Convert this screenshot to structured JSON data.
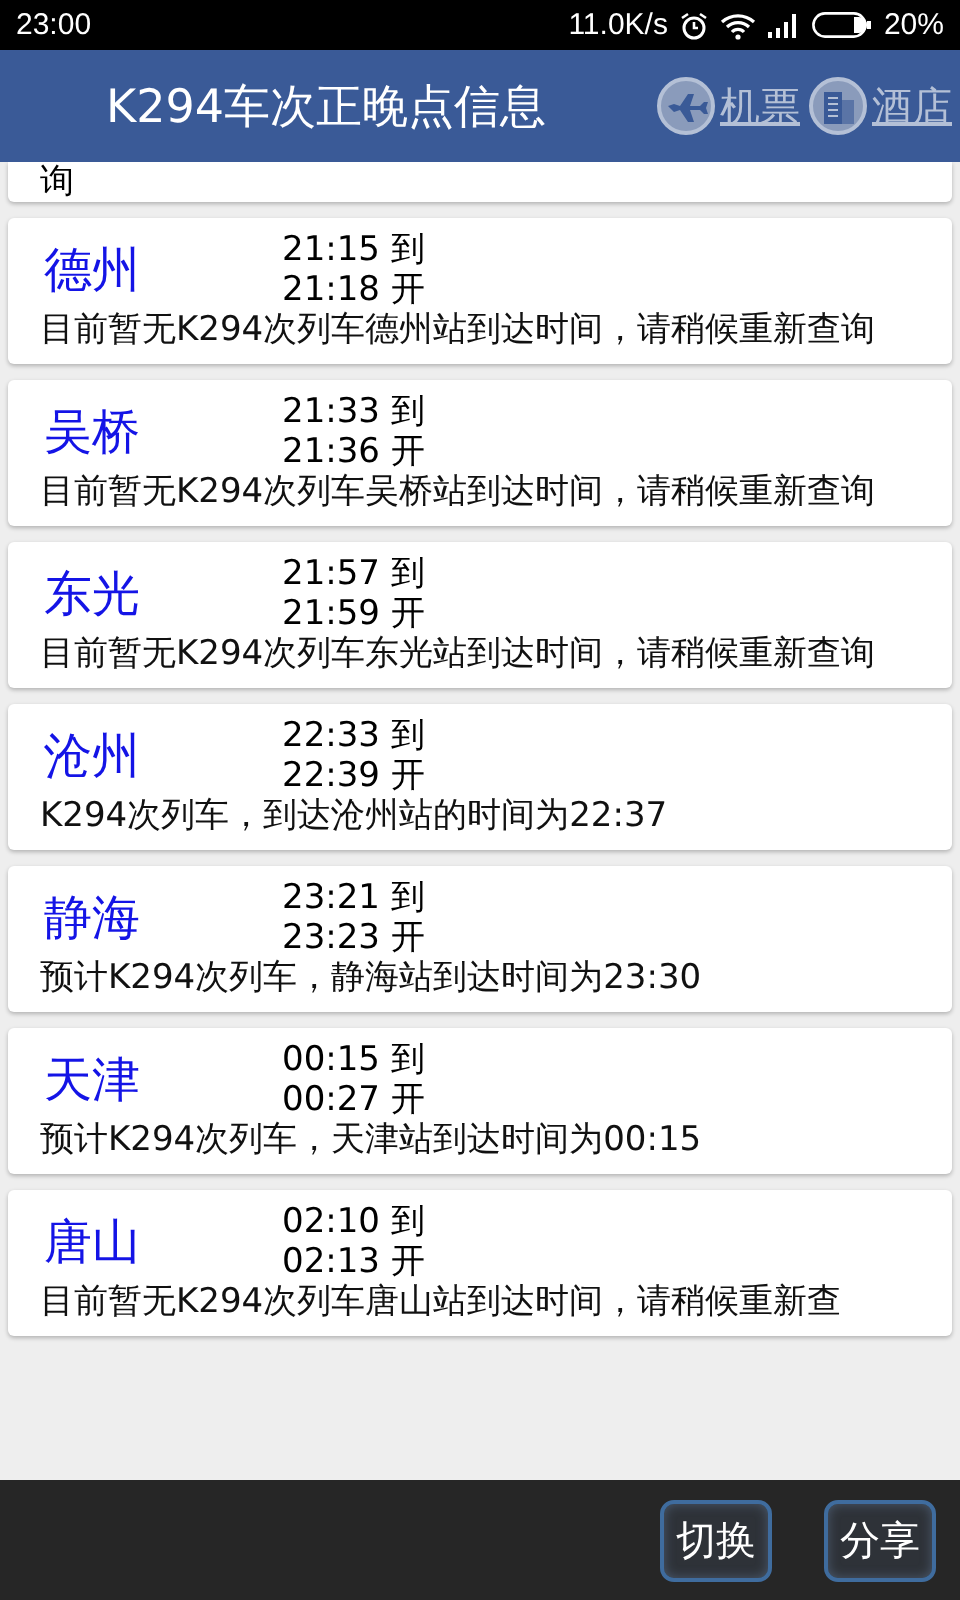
{
  "status_bar": {
    "time": "23:00",
    "speed": "11.0K/s",
    "battery": "20%"
  },
  "header": {
    "title": "K294车次正晚点信息",
    "links": [
      {
        "label": "机票",
        "kind": "plane"
      },
      {
        "label": "酒店",
        "kind": "hotel"
      }
    ]
  },
  "top_fragment": "询",
  "stations": [
    {
      "name": "德州",
      "arrive": "21:15 到",
      "depart": "21:18 开",
      "message": "目前暂无K294次列车德州站到达时间，请稍候重新查询"
    },
    {
      "name": "吴桥",
      "arrive": "21:33 到",
      "depart": "21:36 开",
      "message": "目前暂无K294次列车吴桥站到达时间，请稍候重新查询"
    },
    {
      "name": "东光",
      "arrive": "21:57 到",
      "depart": "21:59 开",
      "message": "目前暂无K294次列车东光站到达时间，请稍候重新查询"
    },
    {
      "name": "沧州",
      "arrive": "22:33 到",
      "depart": "22:39 开",
      "message": "K294次列车，到达沧州站的时间为22:37"
    },
    {
      "name": "静海",
      "arrive": "23:21 到",
      "depart": "23:23 开",
      "message": "预计K294次列车，静海站到达时间为23:30"
    },
    {
      "name": "天津",
      "arrive": "00:15 到",
      "depart": "00:27 开",
      "message": "预计K294次列车，天津站到达时间为00:15"
    },
    {
      "name": "唐山",
      "arrive": "02:10 到",
      "depart": "02:13 开",
      "message": "目前暂无K294次列车唐山站到达时间，请稍候重新查"
    }
  ],
  "bottom_buttons": [
    "切换",
    "分享"
  ]
}
